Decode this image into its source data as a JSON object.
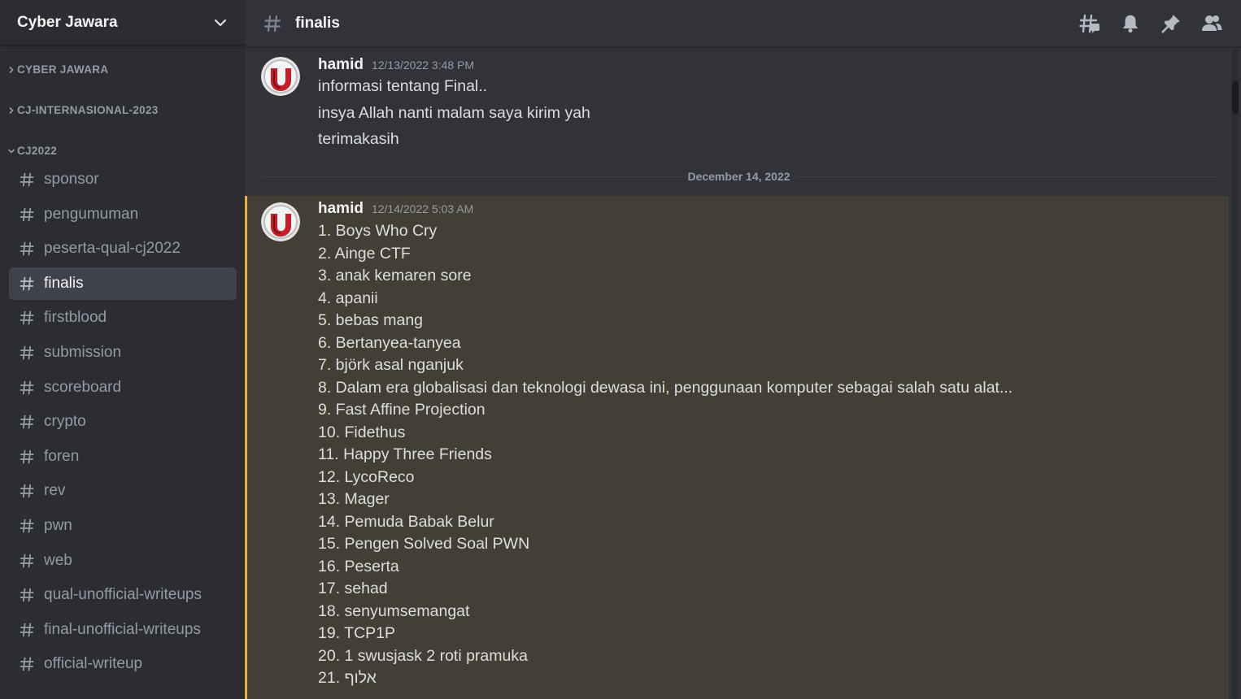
{
  "server": {
    "name": "Cyber Jawara"
  },
  "categories": [
    {
      "label": "CYBER JAWARA",
      "expanded": false
    },
    {
      "label": "CJ-INTERNASIONAL-2023",
      "expanded": false
    },
    {
      "label": "CJ2022",
      "expanded": true
    }
  ],
  "channels": [
    {
      "name": "sponsor"
    },
    {
      "name": "pengumuman"
    },
    {
      "name": "peserta-qual-cj2022"
    },
    {
      "name": "finalis",
      "active": true
    },
    {
      "name": "firstblood"
    },
    {
      "name": "submission"
    },
    {
      "name": "scoreboard"
    },
    {
      "name": "crypto"
    },
    {
      "name": "foren"
    },
    {
      "name": "rev"
    },
    {
      "name": "pwn"
    },
    {
      "name": "web"
    },
    {
      "name": "qual-unofficial-writeups"
    },
    {
      "name": "final-unofficial-writeups"
    },
    {
      "name": "official-writeup"
    }
  ],
  "header": {
    "channel_name": "finalis",
    "icons": [
      "threads-icon",
      "bell-icon",
      "pin-icon",
      "members-icon"
    ]
  },
  "messages": [
    {
      "author": "hamid",
      "timestamp": "12/13/2022 3:48 PM",
      "lines": [
        "informasi tentang Final..",
        "insya Allah nanti malam saya kirim yah",
        "terimakasih"
      ]
    },
    {
      "author": "hamid",
      "timestamp": "12/14/2022 5:03 AM",
      "highlighted": true,
      "lines": [
        "1.  Boys Who Cry",
        "2. Ainge CTF",
        "3. anak kemaren sore",
        "4. apanii",
        "5. bebas mang",
        "6. Bertanyea-tanyea",
        "7. björk asal nganjuk",
        "8. Dalam era globalisasi dan teknologi dewasa ini, penggunaan komputer sebagai salah satu alat...",
        "9. Fast Affine Projection",
        "10. Fidethus",
        "11. Happy Three Friends",
        "12. LycoReco",
        "13. Mager",
        "14. Pemuda Babak Belur",
        "15. Pengen Solved Soal PWN",
        "16. Peserta",
        "17. sehad",
        "18. senyumsemangat",
        "19. TCP1P",
        "20. 1 swusjask 2 roti pramuka",
        "21. אלוף"
      ]
    }
  ],
  "date_divider": "December 14, 2022",
  "colors": {
    "sidebar_bg": "#2b2d31",
    "main_bg": "#313338",
    "active_channel_bg": "#404249",
    "mention_highlight_bg": "#443f36",
    "mention_bar": "#f0b232"
  }
}
